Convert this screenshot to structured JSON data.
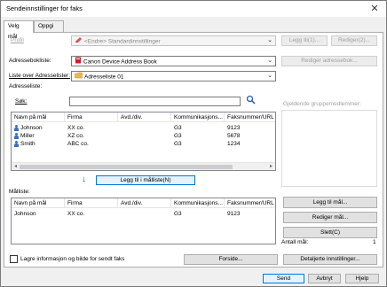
{
  "window": {
    "title": "Sendeinnstillinger for faks",
    "close_glyph": "✕"
  },
  "tabs": [
    {
      "label": "Velg mål",
      "active": true
    },
    {
      "label": "Oppgi mål",
      "active": false
    }
  ],
  "profile": {
    "label": "Profil",
    "value": "<Endre> Standardinnstillinger",
    "save_label": "Legg til(1)...",
    "edit_label": "Rediger(2)..."
  },
  "address_book": {
    "label": "Adressebokliste:",
    "value": "Canon Device Address Book",
    "edit_label": "Rediger adressebok..."
  },
  "address_list": {
    "label": "Liste over Adresselister:",
    "value": "Adresseliste 01"
  },
  "address_list_section": {
    "label": "Adresseliste:",
    "search_label": "Søk:",
    "search_value": ""
  },
  "group_members": {
    "label": "Gjeldende gruppemedlemmer:"
  },
  "address_table": {
    "columns": [
      "Navn på mål",
      "Firma",
      "Avd./div.",
      "Kommunikasjons...",
      "Faksnummer/URL"
    ],
    "rows": [
      {
        "name": "Johnson",
        "company": "XX co.",
        "dept": "",
        "comm": "G3",
        "fax": "9123"
      },
      {
        "name": "Miller",
        "company": "XZ co.",
        "dept": "",
        "comm": "G3",
        "fax": "5678"
      },
      {
        "name": "Smith",
        "company": "ABC co.",
        "dept": "",
        "comm": "G3",
        "fax": "1234"
      }
    ]
  },
  "add_to_target": {
    "label": "Legg til i målliste(N)",
    "arrow_glyph": "↓"
  },
  "target_list": {
    "label": "Målliste:",
    "columns": [
      "Navn på mål",
      "Firma",
      "Avd./div.",
      "Kommunikasjons...",
      "Faksnummer/URL"
    ],
    "rows": [
      {
        "name": "Johnson",
        "company": "XX co.",
        "dept": "",
        "comm": "G3",
        "fax": "9123"
      }
    ]
  },
  "target_actions": {
    "add_label": "Legg til mål...",
    "edit_label": "Rediger mål...",
    "delete_label": "Slett(C)"
  },
  "target_count": {
    "label": "Antall mål:",
    "value": "1"
  },
  "save_info": {
    "label": "Lagre informasjon og bilde for sendt faks",
    "checked": false
  },
  "cover_sheet": {
    "label": "Forside..."
  },
  "detailed_settings": {
    "label": "Detaljerte innstillinger..."
  },
  "footer": {
    "send_label": "Send",
    "cancel_label": "Avbryt",
    "help_label": "Hjelp"
  },
  "colors": {
    "accent": "#0078d7",
    "folder": "#e8b84a",
    "address_book_icon": "#c8202a",
    "pencil": "#d9534f"
  },
  "icons": {
    "search": "search-icon",
    "pencil": "pencil-icon",
    "address_book": "address-book-icon",
    "folder": "folder-icon",
    "person": "person-icon"
  }
}
